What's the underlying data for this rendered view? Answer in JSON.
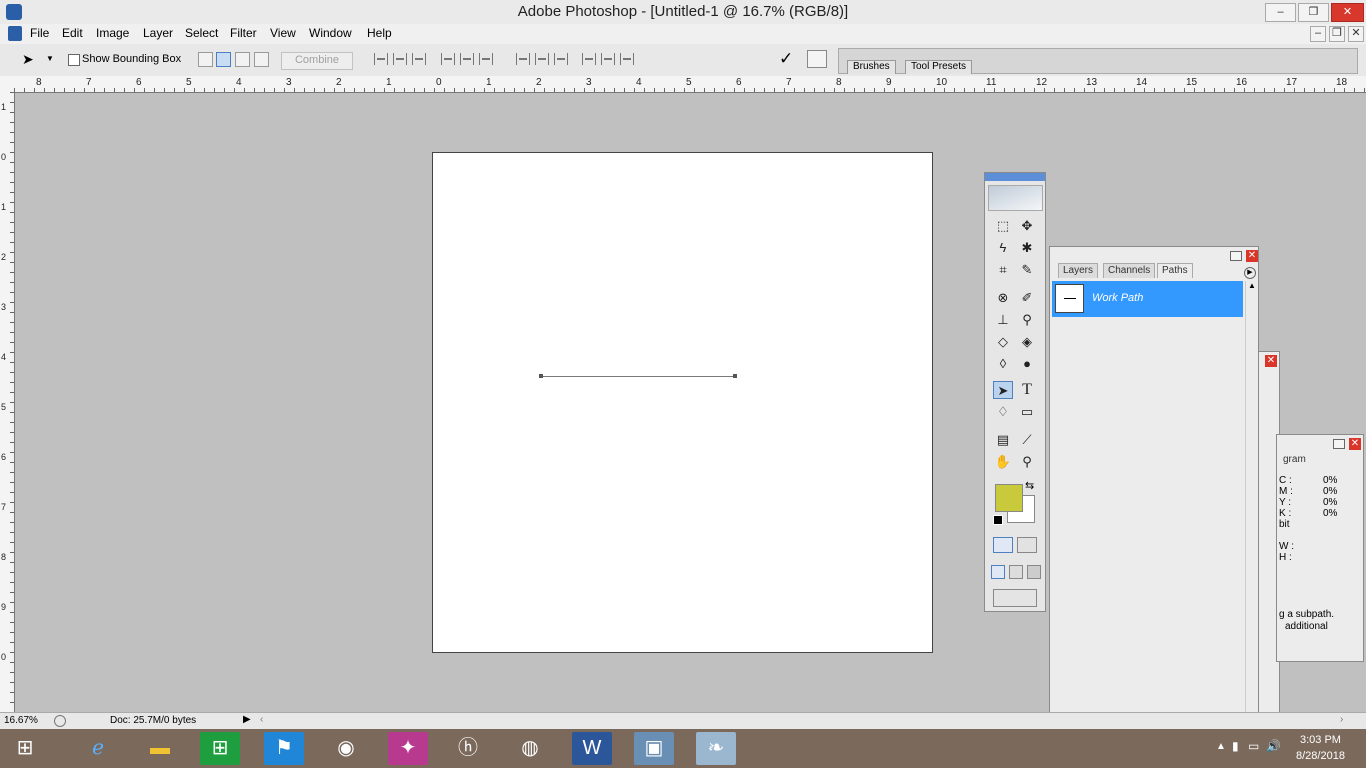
{
  "window": {
    "title": "Adobe Photoshop - [Untitled-1 @ 16.7% (RGB/8)]",
    "btn_minimize": "–",
    "btn_restore": "❐",
    "btn_close": "✕"
  },
  "menu": {
    "items": [
      "File",
      "Edit",
      "Image",
      "Layer",
      "Select",
      "Filter",
      "View",
      "Window",
      "Help"
    ],
    "doc_min": "–",
    "doc_restore": "❐",
    "doc_close": "✕"
  },
  "options": {
    "show_bounding_box": "Show Bounding Box",
    "combine": "Combine",
    "commit": "✓",
    "palette_well_tabs": [
      "Brushes",
      "Tool Presets"
    ]
  },
  "ruler": {
    "h_labels": [
      "8",
      "7",
      "6",
      "5",
      "4",
      "3",
      "2",
      "1",
      "0",
      "1",
      "2",
      "3",
      "4",
      "5",
      "6",
      "7",
      "8",
      "9",
      "10",
      "11",
      "12",
      "13",
      "14",
      "15",
      "16",
      "17",
      "18"
    ],
    "v_labels": [
      "1",
      "0",
      "1",
      "2",
      "3",
      "4",
      "5",
      "6",
      "7",
      "8",
      "9",
      "0"
    ]
  },
  "status": {
    "zoom": "16.67%",
    "doc_info": "Doc: 25.7M/0 bytes"
  },
  "paths_panel": {
    "tabs": [
      "Layers",
      "Channels",
      "Paths"
    ],
    "active_tab": "Paths",
    "item": "Work Path"
  },
  "info_panel": {
    "tab_fragment": "gram",
    "values": [
      "0%",
      "0%",
      "0%",
      "0%"
    ],
    "labels": [
      "C :",
      "M :",
      "Y :",
      "K :"
    ],
    "bit_fragment": "bit",
    "xy_labels": [
      "W :",
      "H :"
    ],
    "hint": "g a subpath.",
    "hint2": "additional"
  },
  "colors": {
    "foreground": "#c9c93c",
    "background": "#ffffff",
    "selection": "#3399ff",
    "taskbar": "#7b6a5c"
  },
  "taskbar": {
    "time": "3:03 PM",
    "date": "8/28/2018"
  }
}
